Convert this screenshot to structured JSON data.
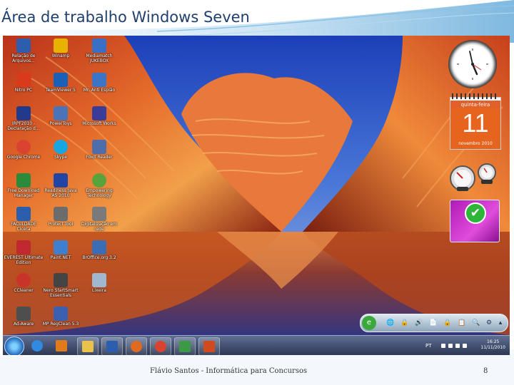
{
  "slide": {
    "title": "Área de trabalho Windows Seven",
    "author": "Flávio Santos - Informática para Concursos",
    "page_number": "8"
  },
  "desktop_icons": [
    {
      "label": "Relação de\nArquivos...",
      "icon": "word-document-icon",
      "color": "#2b5fad"
    },
    {
      "label": "Winamp",
      "icon": "winamp-icon",
      "color": "#e8b300"
    },
    {
      "label": "Mediamatch\nJUKEBOX",
      "icon": "jukebox-icon",
      "color": "#3a6fc7"
    },
    {
      "label": "Nitro PC",
      "icon": "nitro-pdf-icon",
      "color": "#d93a1b"
    },
    {
      "label": "TeamViewer 5",
      "icon": "teamviewer-icon",
      "color": "#1a5fb8"
    },
    {
      "label": "Mr. Anti Espião",
      "icon": "antispy-icon",
      "color": "#3c74c6"
    },
    {
      "label": "IRPF2010 -\nDeclaração d...",
      "icon": "irpf-icon",
      "color": "#223a8c"
    },
    {
      "label": "PowerToys",
      "icon": "powertoys-icon",
      "color": "#4a73b8"
    },
    {
      "label": "Microsoft Works",
      "icon": "works-icon",
      "color": "#3b3b9a"
    },
    {
      "label": "Google Chrome",
      "icon": "chrome-icon",
      "color": "#d9432f"
    },
    {
      "label": "Skype",
      "icon": "skype-icon",
      "color": "#18a6e0"
    },
    {
      "label": "Foxit Reader",
      "icon": "foxit-icon",
      "color": "#4e6dab"
    },
    {
      "label": "Free Download\nManager",
      "icon": "download-manager-icon",
      "color": "#2a8c3b"
    },
    {
      "label": "Readiness Java\nAS 2010",
      "icon": "java-icon",
      "color": "#2245a5"
    },
    {
      "label": "Empowering\nTechnology",
      "icon": "empowering-icon",
      "color": "#5aa33a"
    },
    {
      "label": "FACULDADE\nCicera",
      "icon": "folder-document-icon",
      "color": "#2b5fad"
    },
    {
      "label": "Protect Tool",
      "icon": "protect-tool-icon",
      "color": "#6c6c6c"
    },
    {
      "label": "Digitalização em\nrede",
      "icon": "scanner-icon",
      "color": "#7a7a7a"
    },
    {
      "label": "EVEREST Ultimate\nEdition",
      "icon": "everest-icon",
      "color": "#c0292f"
    },
    {
      "label": "Paint.NET",
      "icon": "paint-net-icon",
      "color": "#3e7fd0"
    },
    {
      "label": "BrOffice.org 3.2",
      "icon": "broffice-icon",
      "color": "#3b6db5"
    },
    {
      "label": "CCleaner",
      "icon": "ccleaner-icon",
      "color": "#c9342a"
    },
    {
      "label": "Nero StartSmart\nEssentials",
      "icon": "nero-icon",
      "color": "#444444"
    },
    {
      "label": "Lixeira",
      "icon": "recycle-bin-icon",
      "color": "#9fb7cf"
    },
    {
      "label": "Ad-Aware",
      "icon": "adaware-icon",
      "color": "#4e4e4e"
    },
    {
      "label": "MP RegClean 5.3",
      "icon": "regclean-icon",
      "color": "#3c60b0"
    }
  ],
  "gadgets": {
    "calendar": {
      "weekday": "quinta-feira",
      "day": "11",
      "month_year": "novembro 2010"
    }
  },
  "windows_search_toolbar": {
    "buttons": [
      "🌐",
      "🔒",
      "🔊",
      "📄",
      "🔒",
      "📋",
      "🔍",
      "⚙",
      "▴"
    ]
  },
  "taskbar": {
    "pinned": [
      {
        "icon": "folder-libraries-icon",
        "color": "#e8c24a"
      },
      {
        "icon": "word-icon",
        "color": "#2b5fad"
      },
      {
        "icon": "firefox-icon",
        "color": "#e06b1f"
      },
      {
        "icon": "chrome-icon",
        "color": "#d9432f"
      },
      {
        "icon": "network-icon",
        "color": "#3a9a45"
      },
      {
        "icon": "powerpoint-icon",
        "color": "#d04a1d"
      }
    ],
    "unpinned": [
      {
        "icon": "internet-explorer-icon",
        "color": "#2f8ae0"
      },
      {
        "icon": "media-player-icon",
        "color": "#e07a1a"
      }
    ],
    "language": "PT",
    "time": "16:25",
    "date": "11/11/2010"
  }
}
